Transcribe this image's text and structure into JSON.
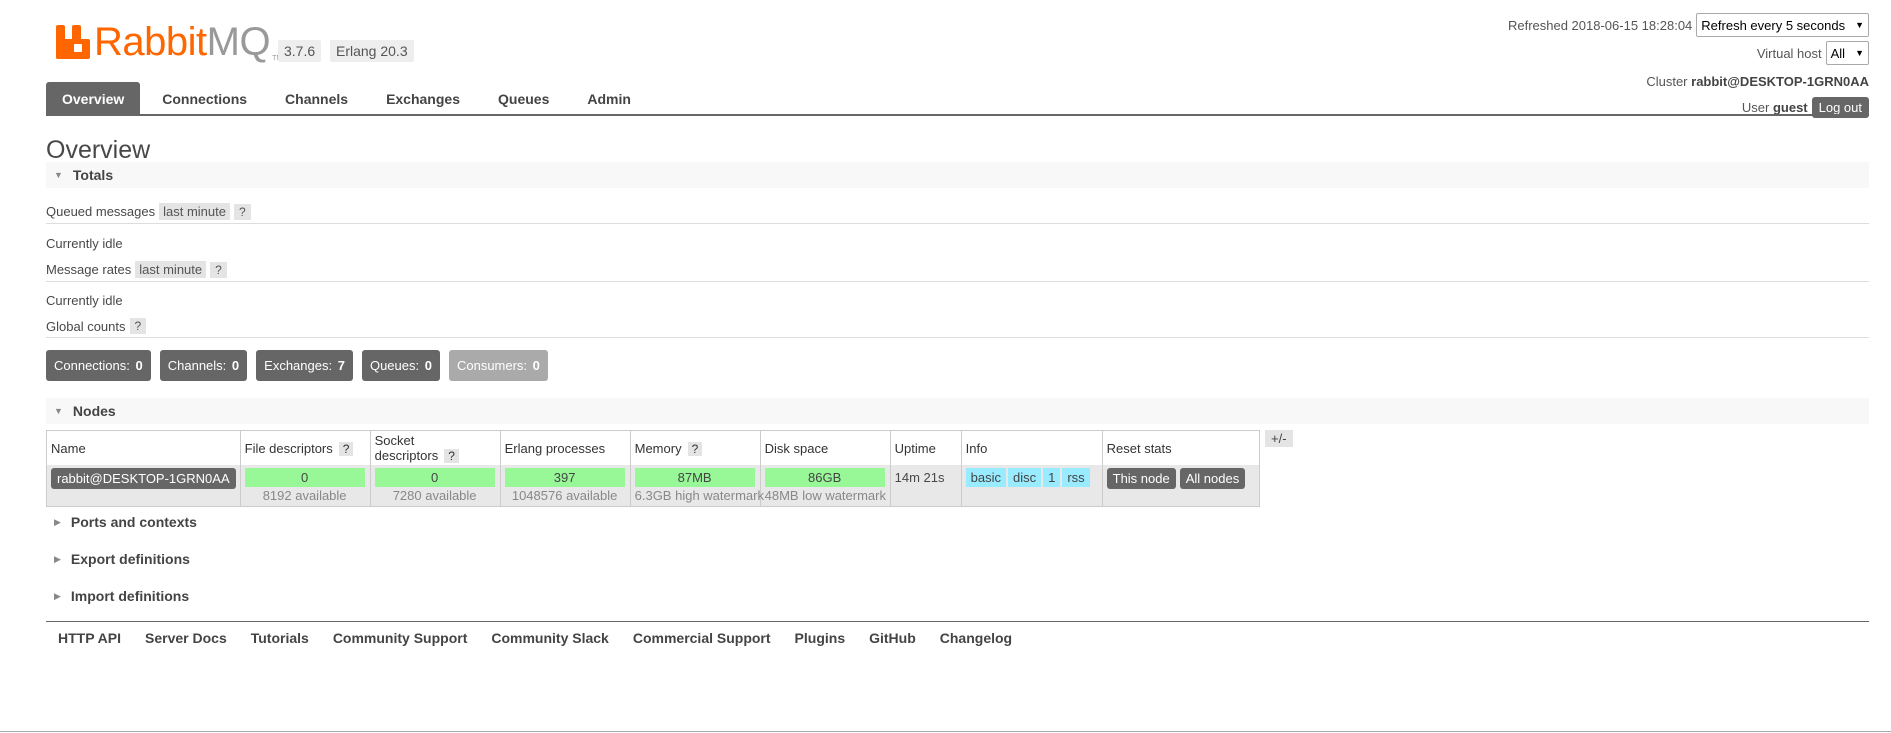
{
  "app": {
    "logo_word": "Rabbit",
    "logo_mq": "MQ",
    "logo_tm": "TM",
    "version": "3.7.6",
    "erlang": "Erlang 20.3",
    "brand_color": "#ff6600"
  },
  "header": {
    "refreshed_label": "Refreshed 2018-06-15 18:28:04",
    "refresh_select": "Refresh every 5 seconds",
    "vhost_label": "Virtual host",
    "vhost_value": "All",
    "cluster_label": "Cluster",
    "cluster_name": "rabbit@DESKTOP-1GRN0AA",
    "user_label": "User",
    "user_name": "guest",
    "logout": "Log out"
  },
  "tabs": [
    {
      "label": "Overview",
      "active": true
    },
    {
      "label": "Connections"
    },
    {
      "label": "Channels"
    },
    {
      "label": "Exchanges"
    },
    {
      "label": "Queues"
    },
    {
      "label": "Admin"
    }
  ],
  "page_title": "Overview",
  "totals": {
    "heading": "Totals",
    "queued_label": "Queued messages",
    "queued_range": "last minute",
    "queued_state": "Currently idle",
    "rates_label": "Message rates",
    "rates_range": "last minute",
    "rates_state": "Currently idle",
    "global_label": "Global counts",
    "help": "?"
  },
  "counts": [
    {
      "label": "Connections:",
      "value": "0"
    },
    {
      "label": "Channels:",
      "value": "0"
    },
    {
      "label": "Exchanges:",
      "value": "7"
    },
    {
      "label": "Queues:",
      "value": "0"
    },
    {
      "label": "Consumers:",
      "value": "0"
    }
  ],
  "nodes": {
    "heading": "Nodes",
    "columns": [
      "Name",
      "File descriptors",
      "Socket descriptors",
      "Erlang processes",
      "Memory",
      "Disk space",
      "Uptime",
      "Info",
      "Reset stats"
    ],
    "help": "?",
    "plus_minus": "+/-",
    "row": {
      "name": "rabbit@DESKTOP-1GRN0AA",
      "fd_value": "0",
      "fd_sub": "8192 available",
      "sd_value": "0",
      "sd_sub": "7280 available",
      "ep_value": "397",
      "ep_sub": "1048576 available",
      "mem_value": "87MB",
      "mem_sub": "6.3GB high watermark",
      "disk_value": "86GB",
      "disk_sub": "48MB low watermark",
      "uptime": "14m 21s",
      "info": [
        "basic",
        "disc",
        "1",
        "rss"
      ],
      "reset_this": "This node",
      "reset_all": "All nodes"
    }
  },
  "collapsed_sections": [
    "Ports and contexts",
    "Export definitions",
    "Import definitions"
  ],
  "footer": [
    "HTTP API",
    "Server Docs",
    "Tutorials",
    "Community Support",
    "Community Slack",
    "Commercial Support",
    "Plugins",
    "GitHub",
    "Changelog"
  ]
}
